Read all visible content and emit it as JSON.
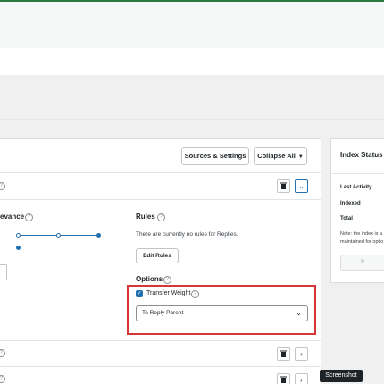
{
  "panel": {
    "sources_button": "Sources & Settings",
    "collapse_button": "Collapse All",
    "relevance_label": "evance",
    "help_glyph": "?",
    "rules_title": "Rules",
    "rules_text": "There are currently no rules for Replies.",
    "edit_rules_button": "Edit Rules",
    "options_title": "Options",
    "transfer_weight_label": "Transfer Weight",
    "transfer_weight_checked": true,
    "transfer_select_value": "To Reply Parent"
  },
  "side": {
    "title": "Index Status",
    "last_activity": "Last Activity",
    "indexed": "Indexed",
    "total": "Total",
    "note_line1": "Note: the index is a",
    "note_line2": "maintained for optio",
    "button": "R"
  },
  "tooltip": "Screenshot",
  "icons": {
    "trash": "trash-icon",
    "chevron_down": "chevron-down-icon",
    "chevron_right": "chevron-right-icon",
    "help": "help-icon",
    "check": "check-icon"
  },
  "colors": {
    "accent": "#2271b1",
    "highlight": "#d63638",
    "top_strip": "#2c7a3f",
    "status_accent": "#dba617"
  }
}
